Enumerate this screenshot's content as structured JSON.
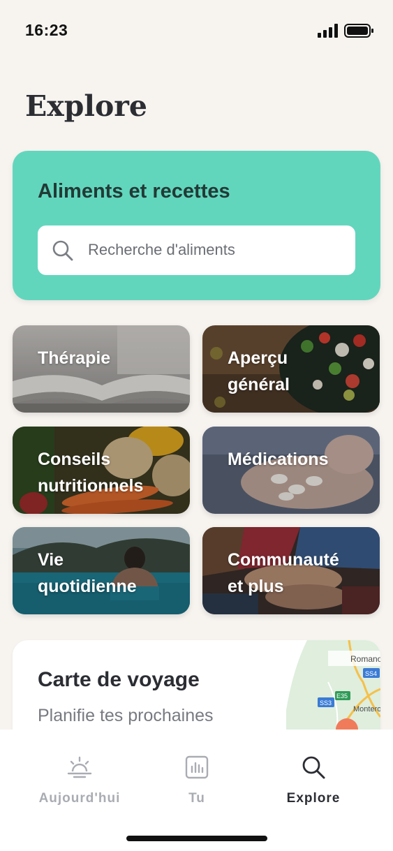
{
  "status_bar": {
    "time": "16:23"
  },
  "page": {
    "title": "Explore"
  },
  "foods": {
    "title": "Aliments et recettes",
    "search_placeholder": "Recherche d'aliments"
  },
  "tiles": [
    {
      "label": "Thérapie"
    },
    {
      "label": "Aperçu\ngénéral"
    },
    {
      "label": "Conseils\nnutritionnels"
    },
    {
      "label": "Médications"
    },
    {
      "label": "Vie\nquotidienne"
    },
    {
      "label": "Communauté\net plus"
    }
  ],
  "travel": {
    "title": "Carte de voyage",
    "subtitle": "Planifie tes prochaines",
    "map_labels": [
      "Romano",
      "SS4",
      "SS3",
      "E35",
      "Monterotondo"
    ]
  },
  "nav": {
    "items": [
      {
        "label": "Aujourd'hui",
        "icon": "sunrise-icon",
        "active": false
      },
      {
        "label": "Tu",
        "icon": "chart-icon",
        "active": false
      },
      {
        "label": "Explore",
        "icon": "search-icon",
        "active": true
      }
    ]
  },
  "colors": {
    "foods_card": "#62d6bd",
    "background": "#f7f4f0",
    "nav_active": "#2b2d33",
    "nav_inactive": "#a9acb2"
  }
}
